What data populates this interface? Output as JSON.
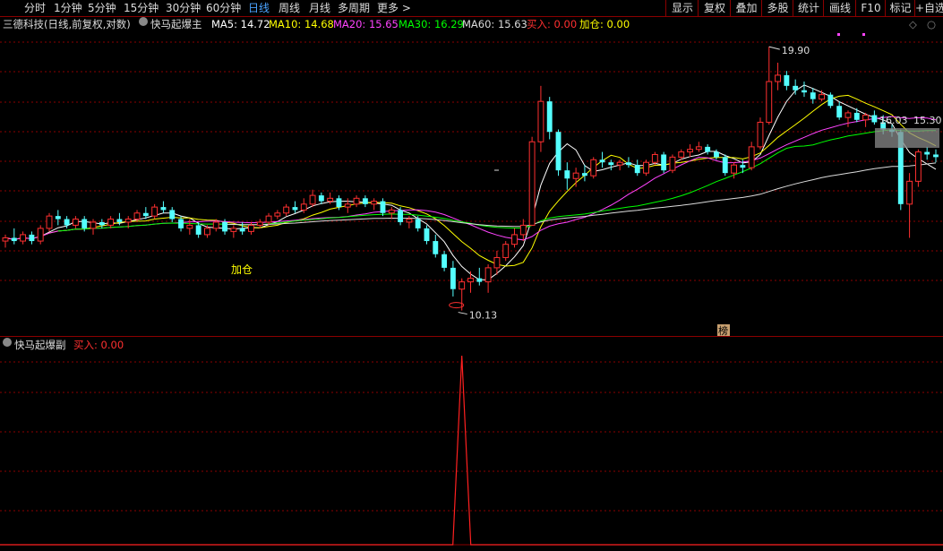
{
  "toolbar": {
    "periods": [
      {
        "label": "分时",
        "active": false
      },
      {
        "label": "1分钟",
        "active": false
      },
      {
        "label": "5分钟",
        "active": false
      },
      {
        "label": "15分钟",
        "active": false
      },
      {
        "label": "30分钟",
        "active": false
      },
      {
        "label": "60分钟",
        "active": false
      },
      {
        "label": "日线",
        "active": true
      },
      {
        "label": "周线",
        "active": false
      },
      {
        "label": "月线",
        "active": false
      },
      {
        "label": "多周期",
        "active": false
      },
      {
        "label": "更多 >",
        "active": false
      }
    ],
    "right_buttons": [
      "显示",
      "复权",
      "叠加",
      "多股",
      "统计",
      "画线",
      "F10",
      "标记",
      "+自选"
    ]
  },
  "main_legend": {
    "stock": "三德科技(日线,前复权,对数)",
    "indicator": "快马起爆主",
    "ma5": "MA5: 14.72",
    "ma10": "MA10: 14.68",
    "ma20": "MA20: 15.65",
    "ma30": "MA30: 16.29",
    "ma60": "MA60: 15.63",
    "buy": "买入: 0.00",
    "add": "加仓: 0.00"
  },
  "sub_legend": {
    "indicator": "快马起爆副",
    "buy": "买入: 0.00"
  },
  "annotations": {
    "high_label": "19.90",
    "low_label": "10.13",
    "add_label": "加仓",
    "rank_label": "榜",
    "price_label_1": "16.03",
    "price_label_2": "15.30",
    "buy_tag": "买入"
  },
  "colors": {
    "up": "#ff3030",
    "down": "#54ffff",
    "ma5": "#ffffff",
    "ma10": "#ffff00",
    "ma20": "#ff44ff",
    "ma30": "#00ff00",
    "ma60": "#dcdcdc",
    "grid": "#8b0000"
  },
  "chart_data": {
    "type": "candlestick",
    "candles_ohlc": [
      [
        12.1,
        12.3,
        11.9,
        12.2
      ],
      [
        12.2,
        12.5,
        12.0,
        12.1
      ],
      [
        12.1,
        12.4,
        12.0,
        12.3
      ],
      [
        12.3,
        12.4,
        12.0,
        12.1
      ],
      [
        12.1,
        12.6,
        12.0,
        12.5
      ],
      [
        12.5,
        13.0,
        12.4,
        12.9
      ],
      [
        12.9,
        13.1,
        12.6,
        12.8
      ],
      [
        12.8,
        12.9,
        12.5,
        12.6
      ],
      [
        12.6,
        12.9,
        12.5,
        12.8
      ],
      [
        12.8,
        12.9,
        12.4,
        12.5
      ],
      [
        12.5,
        12.8,
        12.3,
        12.7
      ],
      [
        12.7,
        12.8,
        12.5,
        12.6
      ],
      [
        12.6,
        12.9,
        12.5,
        12.8
      ],
      [
        12.8,
        13.0,
        12.6,
        12.7
      ],
      [
        12.7,
        12.9,
        12.5,
        12.8
      ],
      [
        12.8,
        13.1,
        12.7,
        13.0
      ],
      [
        13.0,
        13.2,
        12.8,
        12.9
      ],
      [
        12.9,
        13.3,
        12.8,
        13.2
      ],
      [
        13.2,
        13.4,
        13.0,
        13.1
      ],
      [
        13.1,
        13.2,
        12.7,
        12.8
      ],
      [
        12.8,
        12.9,
        12.4,
        12.5
      ],
      [
        12.5,
        12.8,
        12.3,
        12.6
      ],
      [
        12.6,
        12.7,
        12.2,
        12.3
      ],
      [
        12.3,
        12.6,
        12.2,
        12.5
      ],
      [
        12.5,
        12.8,
        12.4,
        12.7
      ],
      [
        12.7,
        12.8,
        12.3,
        12.4
      ],
      [
        12.4,
        12.6,
        12.2,
        12.5
      ],
      [
        12.5,
        12.7,
        12.3,
        12.4
      ],
      [
        12.4,
        12.7,
        12.3,
        12.6
      ],
      [
        12.6,
        12.8,
        12.5,
        12.7
      ],
      [
        12.7,
        13.0,
        12.6,
        12.9
      ],
      [
        12.9,
        13.1,
        12.8,
        13.0
      ],
      [
        13.0,
        13.3,
        12.9,
        13.2
      ],
      [
        13.2,
        13.4,
        13.0,
        13.1
      ],
      [
        13.1,
        13.5,
        13.0,
        13.3
      ],
      [
        13.3,
        13.8,
        13.2,
        13.6
      ],
      [
        13.6,
        13.7,
        13.3,
        13.4
      ],
      [
        13.4,
        13.7,
        13.3,
        13.5
      ],
      [
        13.5,
        13.6,
        13.1,
        13.2
      ],
      [
        13.2,
        13.5,
        13.0,
        13.3
      ],
      [
        13.3,
        13.6,
        13.2,
        13.5
      ],
      [
        13.5,
        13.6,
        13.2,
        13.3
      ],
      [
        13.3,
        13.5,
        13.1,
        13.4
      ],
      [
        13.4,
        13.5,
        12.9,
        13.0
      ],
      [
        13.0,
        13.2,
        12.8,
        13.1
      ],
      [
        13.1,
        13.2,
        12.6,
        12.7
      ],
      [
        12.7,
        12.9,
        12.5,
        12.8
      ],
      [
        12.8,
        12.9,
        12.4,
        12.5
      ],
      [
        12.5,
        12.6,
        12.0,
        12.1
      ],
      [
        12.1,
        12.3,
        11.6,
        11.7
      ],
      [
        11.7,
        11.8,
        11.2,
        11.3
      ],
      [
        11.3,
        11.5,
        10.5,
        10.7
      ],
      [
        10.7,
        11.0,
        10.13,
        10.9
      ],
      [
        10.9,
        11.2,
        10.6,
        11.0
      ],
      [
        11.0,
        11.3,
        10.8,
        10.9
      ],
      [
        10.9,
        11.4,
        10.6,
        11.3
      ],
      [
        11.3,
        11.8,
        11.1,
        11.6
      ],
      [
        11.6,
        12.1,
        11.5,
        12.0
      ],
      [
        12.0,
        12.5,
        11.9,
        12.3
      ],
      [
        12.3,
        12.8,
        12.1,
        12.6
      ],
      [
        12.6,
        15.8,
        12.6,
        15.6
      ],
      [
        15.6,
        18.0,
        15.2,
        17.3
      ],
      [
        17.3,
        17.5,
        15.7,
        16.0
      ],
      [
        16.0,
        16.1,
        14.3,
        14.5
      ],
      [
        14.5,
        14.8,
        13.8,
        14.2
      ],
      [
        14.2,
        14.6,
        13.9,
        14.4
      ],
      [
        14.4,
        14.7,
        14.1,
        14.3
      ],
      [
        14.3,
        15.0,
        14.2,
        14.9
      ],
      [
        14.9,
        15.2,
        14.6,
        14.8
      ],
      [
        14.8,
        14.9,
        14.5,
        14.7
      ],
      [
        14.7,
        14.9,
        14.5,
        14.8
      ],
      [
        14.8,
        15.0,
        14.6,
        14.7
      ],
      [
        14.7,
        14.9,
        14.3,
        14.4
      ],
      [
        14.4,
        14.9,
        14.3,
        14.8
      ],
      [
        14.8,
        15.2,
        14.7,
        15.1
      ],
      [
        15.1,
        15.2,
        14.4,
        14.5
      ],
      [
        14.5,
        15.1,
        14.4,
        15.0
      ],
      [
        15.0,
        15.3,
        14.9,
        15.2
      ],
      [
        15.2,
        15.5,
        15.0,
        15.3
      ],
      [
        15.3,
        15.6,
        15.2,
        15.4
      ],
      [
        15.4,
        15.5,
        15.1,
        15.2
      ],
      [
        15.2,
        15.3,
        14.9,
        15.0
      ],
      [
        15.0,
        15.1,
        14.3,
        14.4
      ],
      [
        14.4,
        14.8,
        14.2,
        14.7
      ],
      [
        14.7,
        14.9,
        14.4,
        14.6
      ],
      [
        14.6,
        15.6,
        14.5,
        15.4
      ],
      [
        15.4,
        16.6,
        15.3,
        16.4
      ],
      [
        16.4,
        19.9,
        16.3,
        18.2
      ],
      [
        18.2,
        19.1,
        17.8,
        18.5
      ],
      [
        18.5,
        18.7,
        17.8,
        18.0
      ],
      [
        18.0,
        18.3,
        17.6,
        17.8
      ],
      [
        17.8,
        18.2,
        17.5,
        17.7
      ],
      [
        17.7,
        17.9,
        17.2,
        17.4
      ],
      [
        17.4,
        17.8,
        17.3,
        17.6
      ],
      [
        17.6,
        17.7,
        17.0,
        17.1
      ],
      [
        17.1,
        17.3,
        16.5,
        16.6
      ],
      [
        16.6,
        16.9,
        16.2,
        16.8
      ],
      [
        16.8,
        17.0,
        16.4,
        16.5
      ],
      [
        16.5,
        16.8,
        16.2,
        16.7
      ],
      [
        16.7,
        16.9,
        16.3,
        16.4
      ],
      [
        16.4,
        16.7,
        15.9,
        16.1
      ],
      [
        16.1,
        16.3,
        15.8,
        16.0
      ],
      [
        16.0,
        16.1,
        13.1,
        13.3
      ],
      [
        13.3,
        14.4,
        12.2,
        14.1
      ],
      [
        14.1,
        15.3,
        13.9,
        15.2
      ],
      [
        15.2,
        15.4,
        14.9,
        15.1
      ],
      [
        15.1,
        15.3,
        14.8,
        15.0
      ]
    ],
    "price_labels": [
      "19.90",
      "10.13",
      "16.03",
      "15.30"
    ],
    "sub_signal": {
      "type": "line",
      "peak_index": 52,
      "peak_value": 1.0
    }
  }
}
